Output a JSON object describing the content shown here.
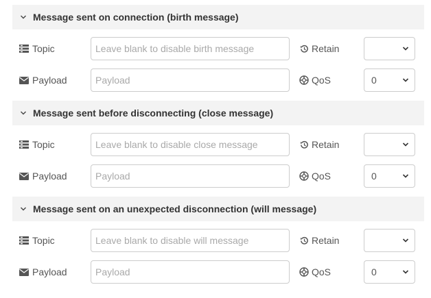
{
  "sections": [
    {
      "title": "Message sent on connection (birth message)",
      "topic_label": "Topic",
      "topic_placeholder": "Leave blank to disable birth message",
      "topic_value": "",
      "retain_label": "Retain",
      "retain_value": "",
      "payload_label": "Payload",
      "payload_placeholder": "Payload",
      "payload_value": "",
      "qos_label": "QoS",
      "qos_value": "0"
    },
    {
      "title": "Message sent before disconnecting (close message)",
      "topic_label": "Topic",
      "topic_placeholder": "Leave blank to disable close message",
      "topic_value": "",
      "retain_label": "Retain",
      "retain_value": "",
      "payload_label": "Payload",
      "payload_placeholder": "Payload",
      "payload_value": "",
      "qos_label": "QoS",
      "qos_value": "0"
    },
    {
      "title": "Message sent on an unexpected disconnection (will message)",
      "topic_label": "Topic",
      "topic_placeholder": "Leave blank to disable will message",
      "topic_value": "",
      "retain_label": "Retain",
      "retain_value": "",
      "payload_label": "Payload",
      "payload_placeholder": "Payload",
      "payload_value": "",
      "qos_label": "QoS",
      "qos_value": "0"
    }
  ],
  "icons": {
    "section_toggle": "chevron-down-icon",
    "topic": "tasks-list-icon",
    "payload": "envelope-icon",
    "retain": "history-icon",
    "qos": "life-ring-icon",
    "select_caret": "chevron-down-icon"
  },
  "colors": {
    "header_background": "#f3f3f3",
    "title_text": "#333333",
    "label_text": "#555555",
    "placeholder_text": "#a9a9a9",
    "input_border": "#cccccc"
  }
}
